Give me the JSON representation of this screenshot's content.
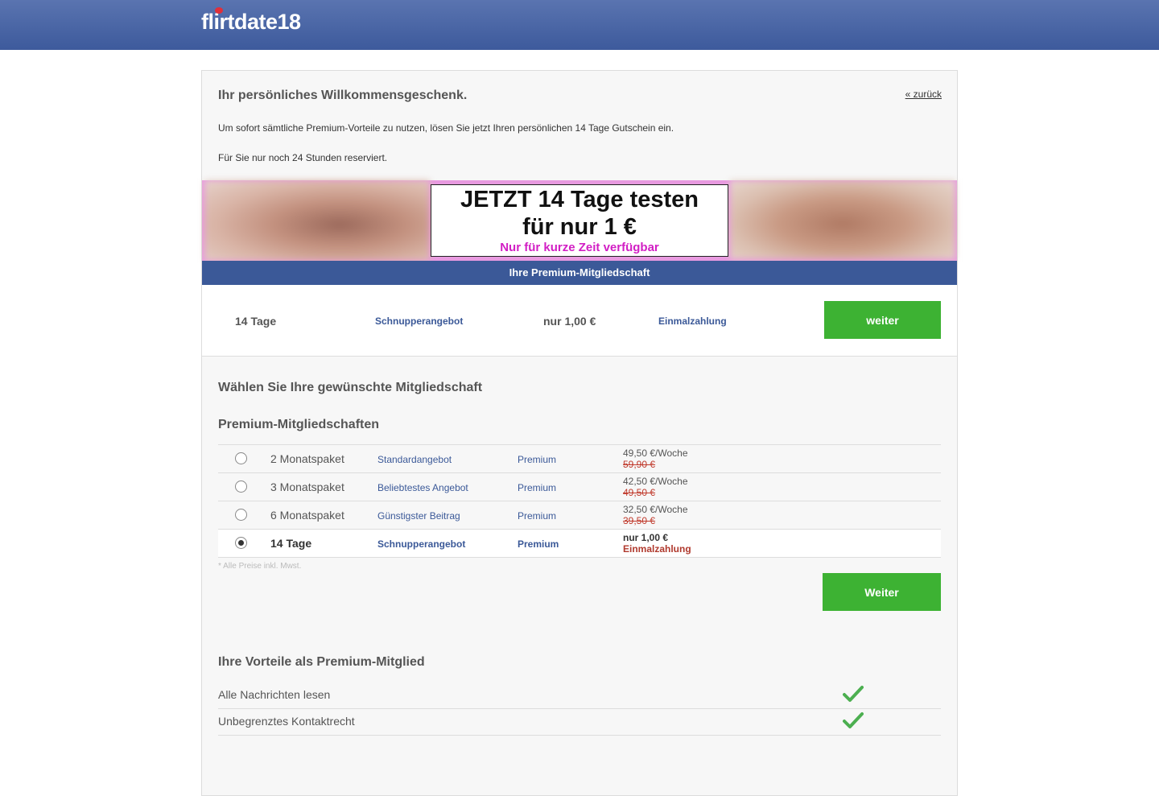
{
  "header": {
    "logo_text": "flirtdate18"
  },
  "welcome": {
    "title": "Ihr persönliches Willkommensgeschenk.",
    "back_link": "« zurück",
    "intro": "Um sofort sämtliche Premium-Vorteile zu nutzen, lösen Sie jetzt Ihren persönlichen 14 Tage Gutschein ein.",
    "reserved": "Für Sie nur noch 24 Stunden reserviert."
  },
  "promo": {
    "line1": "JETZT 14 Tage testen",
    "line2": "für nur 1 €",
    "line3": "Nur für kurze Zeit verfügbar"
  },
  "premium_bar": {
    "label": "Ihre Premium-Mitgliedschaft"
  },
  "offer": {
    "duration": "14 Tage",
    "type": "Schnupperangebot",
    "price": "nur 1,00 €",
    "payment": "Einmalzahlung",
    "button": "weiter"
  },
  "selection": {
    "title": "Wählen Sie Ihre gewünschte Mitgliedschaft",
    "subtitle": "Premium-Mitgliedschaften",
    "plans": [
      {
        "name": "2 Monatspaket",
        "desc": "Standardangebot",
        "level": "Premium",
        "price": "49,50 €/Woche",
        "old": "59,90 €",
        "selected": false
      },
      {
        "name": "3 Monatspaket",
        "desc": "Beliebtestes Angebot",
        "level": "Premium",
        "price": "42,50 €/Woche",
        "old": "49,50 €",
        "selected": false
      },
      {
        "name": "6 Monatspaket",
        "desc": "Günstigster Beitrag",
        "level": "Premium",
        "price": "32,50 €/Woche",
        "old": "39,50 €",
        "selected": false
      },
      {
        "name": "14 Tage",
        "desc": "Schnupperangebot",
        "level": "Premium",
        "price": "nur 1,00 €",
        "sub": "Einmalzahlung",
        "selected": true
      }
    ],
    "vat_note": "* Alle Preise inkl. Mwst.",
    "button": "Weiter"
  },
  "benefits": {
    "title": "Ihre Vorteile als Premium-Mitglied",
    "items": [
      "Alle Nachrichten lesen",
      "Unbegrenztes Kontaktrecht"
    ]
  },
  "colors": {
    "brand_blue": "#3b5998",
    "button_green": "#3db233",
    "promo_pink": "#d21ec4",
    "check_green": "#4caf50"
  }
}
